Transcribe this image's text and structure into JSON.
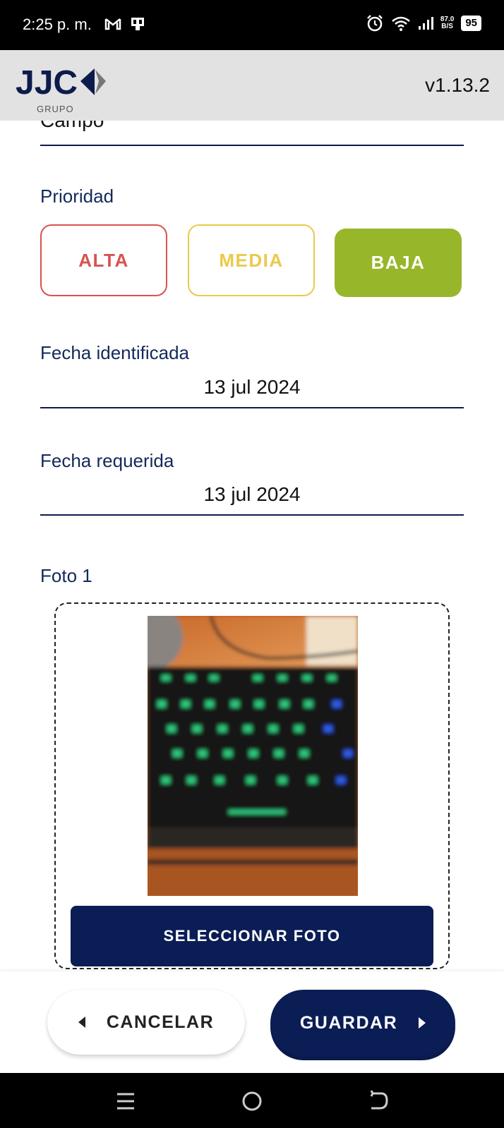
{
  "status_bar": {
    "time": "2:25 p. m.",
    "net_speed_value": "87.0",
    "net_speed_unit": "B/S",
    "battery": "95",
    "icons": [
      "gmail-icon",
      "sim-icon",
      "alarm-icon",
      "wifi-icon",
      "signal-icon",
      "battery-icon"
    ]
  },
  "header": {
    "logo_text": "JJC",
    "logo_sub": "GRUPO",
    "version": "v1.13.2"
  },
  "form": {
    "area_value": "Campo",
    "priority_label": "Prioridad",
    "priorities": [
      {
        "label": "ALTA",
        "color": "#d9534f",
        "selected": false
      },
      {
        "label": "MEDIA",
        "color": "#ecc94b",
        "selected": false
      },
      {
        "label": "BAJA",
        "color": "#97b62a",
        "selected": true
      }
    ],
    "identified_date_label": "Fecha identificada",
    "identified_date_value": "13 jul 2024",
    "required_date_label": "Fecha requerida",
    "required_date_value": "13 jul 2024",
    "photo1_label": "Foto 1",
    "select_photo_label": "SELECCIONAR FOTO"
  },
  "actions": {
    "cancel_label": "CANCELAR",
    "save_label": "GUARDAR",
    "primary_color": "#0b1d55"
  },
  "nav": {
    "icons": [
      "menu-icon",
      "home-icon",
      "back-icon"
    ]
  }
}
